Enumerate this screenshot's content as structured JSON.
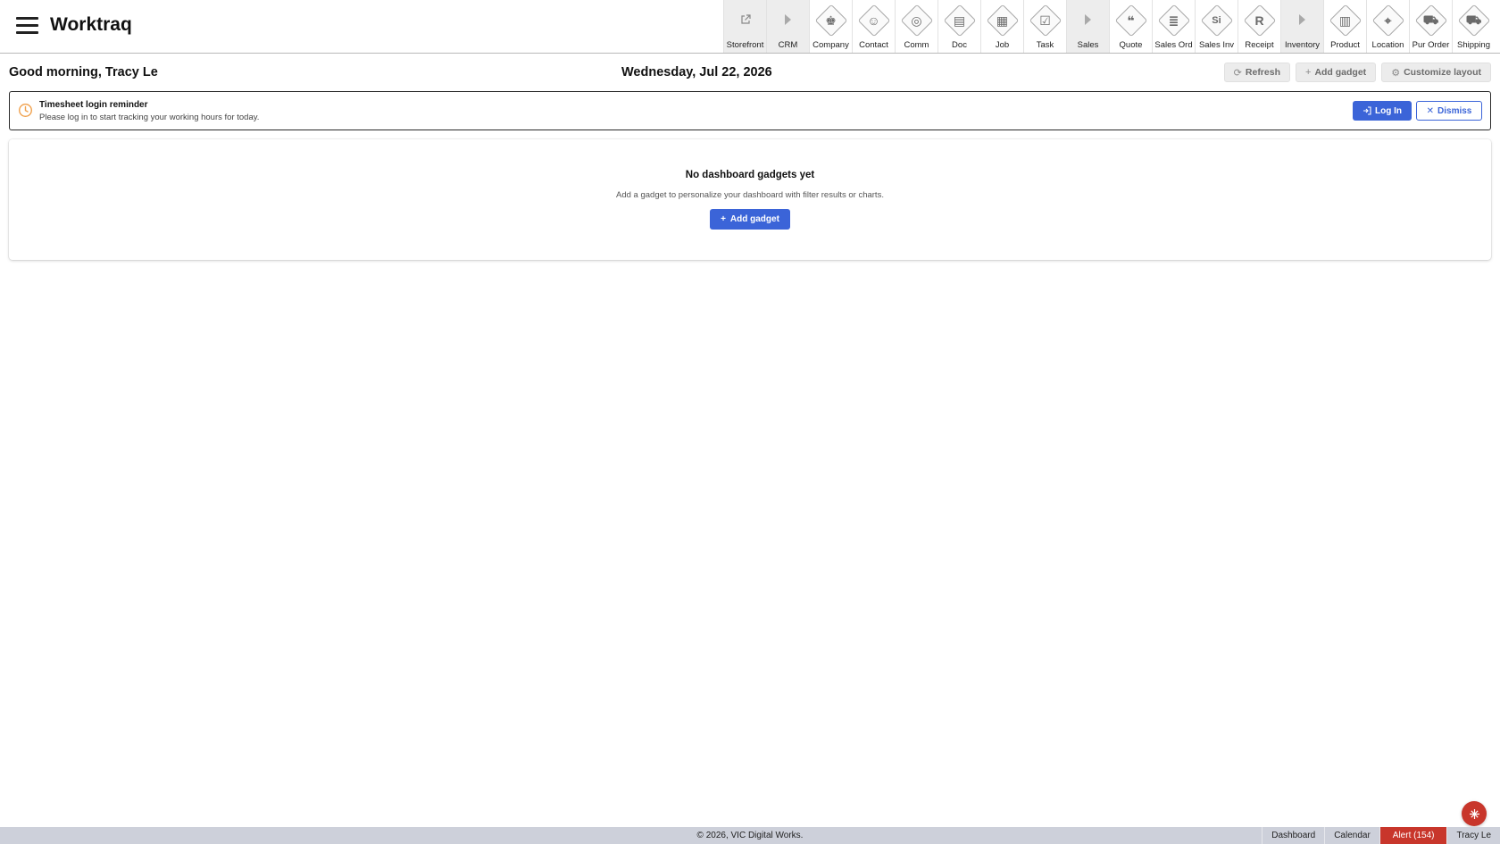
{
  "app": {
    "title": "Worktraq"
  },
  "nav": [
    {
      "label": "Storefront",
      "icon": "external-link-icon",
      "kind": "link"
    },
    {
      "label": "CRM",
      "icon": "caret-right-icon",
      "kind": "group"
    },
    {
      "label": "Company",
      "icon": "company-icon",
      "glyph": "♚"
    },
    {
      "label": "Contact",
      "icon": "contact-icon",
      "glyph": "☺"
    },
    {
      "label": "Comm",
      "icon": "comm-icon",
      "glyph": "◎"
    },
    {
      "label": "Doc",
      "icon": "doc-icon",
      "glyph": "▤"
    },
    {
      "label": "Job",
      "icon": "job-icon",
      "glyph": "▦"
    },
    {
      "label": "Task",
      "icon": "task-icon",
      "glyph": "☑"
    },
    {
      "label": "Sales",
      "icon": "caret-right-icon",
      "kind": "group"
    },
    {
      "label": "Quote",
      "icon": "quote-icon",
      "glyph": "❝"
    },
    {
      "label": "Sales Ord",
      "icon": "sales-order-icon",
      "glyph": "≣"
    },
    {
      "label": "Sales Inv",
      "icon": "sales-invoice-icon",
      "glyph": "Si"
    },
    {
      "label": "Receipt",
      "icon": "receipt-icon",
      "glyph": "R"
    },
    {
      "label": "Inventory",
      "icon": "caret-right-icon",
      "kind": "group"
    },
    {
      "label": "Product",
      "icon": "product-icon",
      "glyph": "▥"
    },
    {
      "label": "Location",
      "icon": "location-icon",
      "glyph": "⌖"
    },
    {
      "label": "Pur Order",
      "icon": "purchase-order-icon",
      "glyph": "⛟"
    },
    {
      "label": "Shipping",
      "icon": "shipping-icon",
      "glyph": "⛟"
    }
  ],
  "header": {
    "greeting": "Good morning, Tracy Le",
    "date": "Wednesday, Jul 22, 2026",
    "refresh_label": "Refresh",
    "add_gadget_label": "Add gadget",
    "customize_label": "Customize layout"
  },
  "reminder": {
    "title": "Timesheet login reminder",
    "text": "Please log in to start tracking your working hours for today.",
    "login_label": "Log In",
    "dismiss_label": "Dismiss"
  },
  "empty_state": {
    "title": "No dashboard gadgets yet",
    "text": "Add a gadget to personalize your dashboard with filter results or charts.",
    "button_label": "Add gadget"
  },
  "footer": {
    "copyright": "© 2026, VIC Digital Works.",
    "links": [
      "Dashboard",
      "Calendar",
      "Alert (154)",
      "Tracy Le"
    ]
  },
  "colors": {
    "primary": "#3b64d8",
    "alert": "#c8362b",
    "warning_icon": "#f0a04b",
    "footer_bg": "#cdd0da"
  }
}
